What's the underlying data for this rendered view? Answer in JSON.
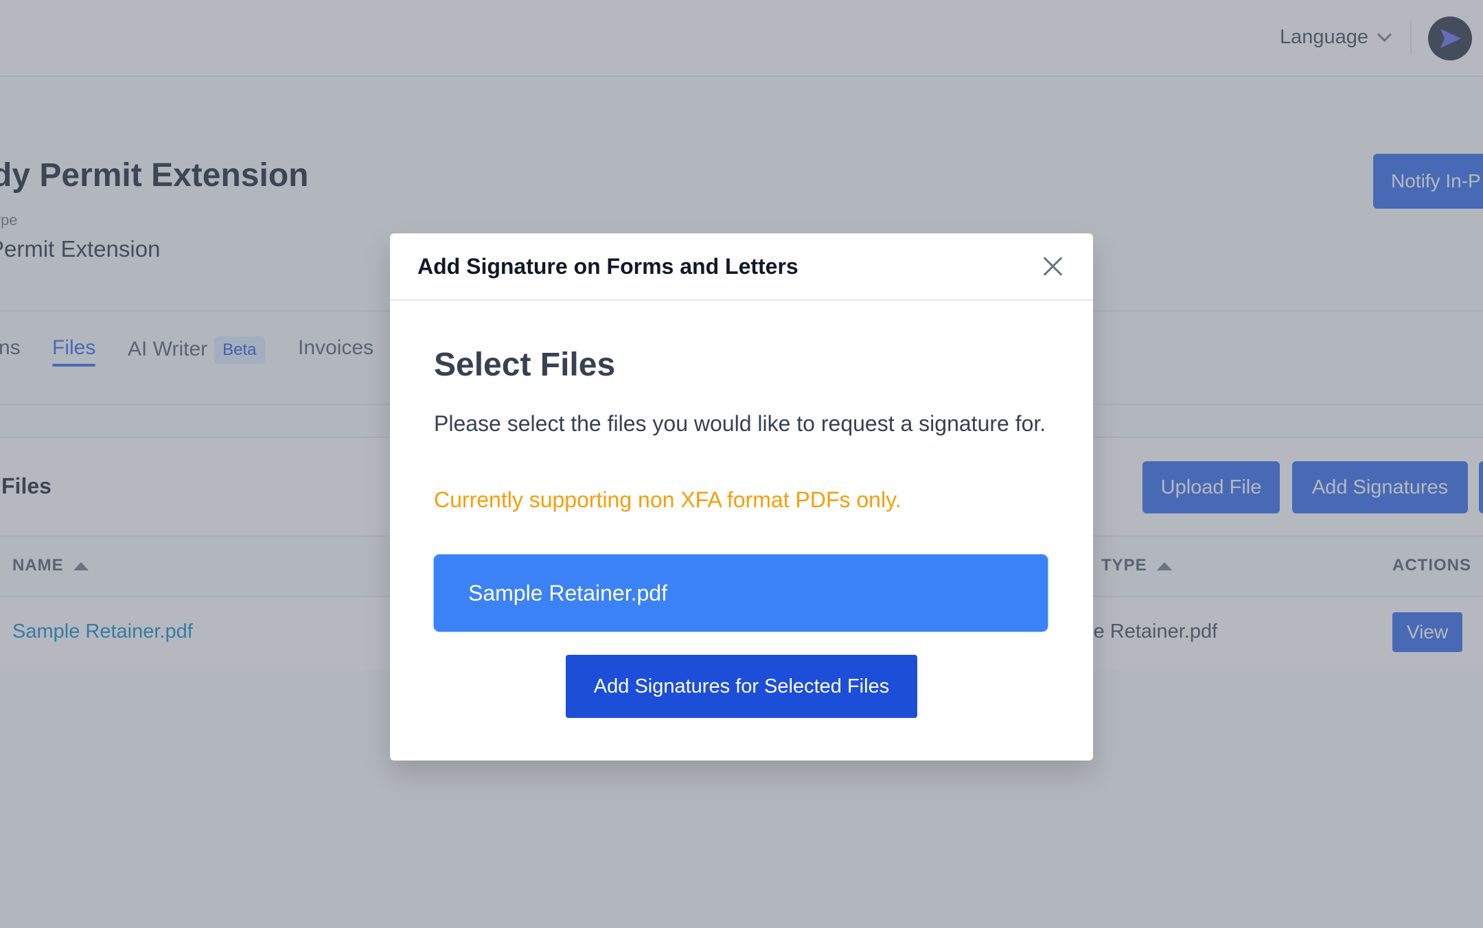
{
  "header": {
    "language_label": "Language"
  },
  "case": {
    "title": "dy Permit Extension",
    "subtitle_label": "ype",
    "subtitle_value": " Permit Extension",
    "notify_label": "Notify In-P"
  },
  "tabs": [
    {
      "label": "ns"
    },
    {
      "label": "Files"
    },
    {
      "label": "AI Writer",
      "badge": "Beta"
    },
    {
      "label": "Invoices"
    }
  ],
  "files_section": {
    "heading": "Files",
    "upload_label": "Upload File",
    "add_signatures_label": "Add Signatures",
    "columns": {
      "name": "NAME",
      "type": "TYPE",
      "actions": "ACTIONS"
    },
    "rows": [
      {
        "name": "Sample Retainer.pdf",
        "type": "ple Retainer.pdf",
        "action": "View"
      }
    ]
  },
  "modal": {
    "title": "Add Signature on Forms and Letters",
    "heading": "Select Files",
    "description": "Please select the files you would like to request a signature for.",
    "warning": "Currently supporting non XFA format PDFs only.",
    "files": [
      {
        "name": "Sample Retainer.pdf",
        "selected": true
      }
    ],
    "submit_label": "Add Signatures for Selected Files"
  },
  "colors": {
    "accent": "#2563eb",
    "selected_file": "#3b82f6",
    "warning": "#f59e0b",
    "link": "#0284c7"
  }
}
